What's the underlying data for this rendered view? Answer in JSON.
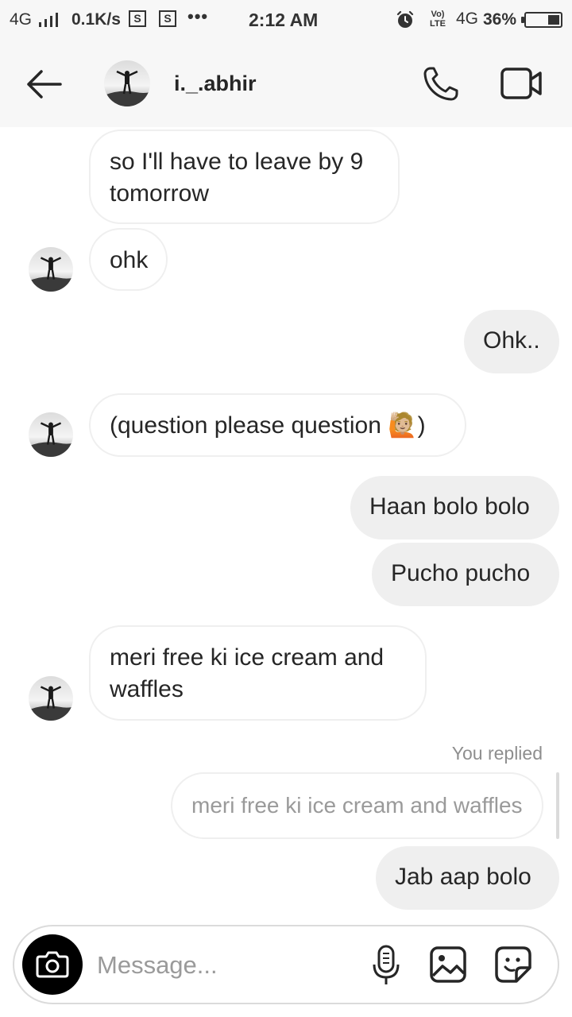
{
  "status_bar": {
    "network_left": "4G",
    "speed": "0.1K/s",
    "screenshot_icon_label": "S",
    "overflow": "•••",
    "time": "2:12 AM",
    "volte": "Vo) LTE",
    "network_right": "4G",
    "battery_percent": "36%",
    "battery_level": 0.36
  },
  "header": {
    "username": "i._.abhir",
    "icons": [
      "back-arrow-icon",
      "phone-icon",
      "video-camera-icon"
    ]
  },
  "messages": [
    {
      "sender": "them",
      "text": "so I'll have to leave by 9 tomorrow"
    },
    {
      "sender": "them",
      "text": "ohk"
    },
    {
      "sender": "me",
      "text": "Ohk.."
    },
    {
      "sender": "them",
      "text": "(question please question 🙋🏼)"
    },
    {
      "sender": "me",
      "text": "Haan bolo bolo"
    },
    {
      "sender": "me",
      "text": "Pucho pucho"
    },
    {
      "sender": "them",
      "text": "meri free ki ice cream and waffles"
    },
    {
      "sender": "me",
      "text": "Jab aap bolo",
      "replied_label": "You replied",
      "quoted_text": "meri free ki ice cream and waffles"
    }
  ],
  "composer": {
    "placeholder": "Message...",
    "icons": [
      "camera-icon",
      "microphone-icon",
      "gallery-icon",
      "sticker-icon"
    ]
  },
  "colors": {
    "outgoing_bubble": "#efefef",
    "incoming_border": "#efefef",
    "header_bg": "#f7f7f7",
    "muted_text": "#8e8e8e"
  }
}
